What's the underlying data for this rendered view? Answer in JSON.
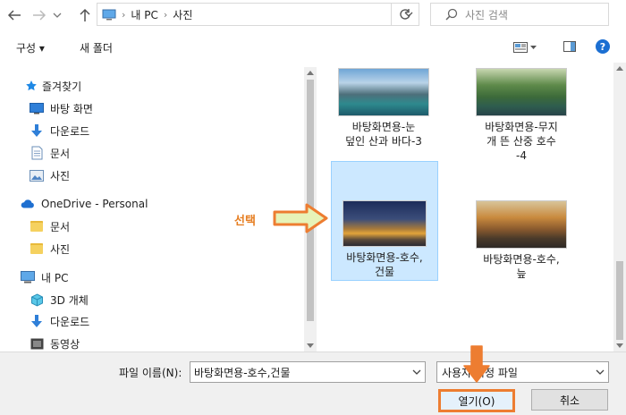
{
  "address_bar": {
    "crumbs": [
      "내 PC",
      "사진"
    ],
    "search_placeholder": "사진 검색"
  },
  "toolbar": {
    "organize_label": "구성 ▾",
    "new_folder_label": "새 폴더"
  },
  "sidebar": {
    "items": [
      {
        "label": "즐겨찾기",
        "icon": "star-icon"
      },
      {
        "label": "바탕 화면",
        "icon": "desktop-icon"
      },
      {
        "label": "다운로드",
        "icon": "download-icon"
      },
      {
        "label": "문서",
        "icon": "document-icon"
      },
      {
        "label": "사진",
        "icon": "pictures-icon"
      },
      {
        "label": "OneDrive - Personal",
        "icon": "cloud-icon"
      },
      {
        "label": "문서",
        "icon": "folder-icon"
      },
      {
        "label": "사진",
        "icon": "folder-icon"
      },
      {
        "label": "내 PC",
        "icon": "pc-icon"
      },
      {
        "label": "3D 개체",
        "icon": "cube-icon"
      },
      {
        "label": "다운로드",
        "icon": "download-icon"
      },
      {
        "label": "동영상",
        "icon": "video-icon"
      }
    ]
  },
  "files": [
    {
      "caption_lines": [
        "바탕화면용-눈",
        "덮인 산과 바다-3"
      ],
      "selected": false
    },
    {
      "caption_lines": [
        "바탕화면용-무지",
        "개 뜬 산중 호수",
        "-4"
      ],
      "selected": false
    },
    {
      "caption_lines": [
        "바탕화면용-호수,",
        "건물"
      ],
      "selected": true
    },
    {
      "caption_lines": [
        "바탕화면용-호수,",
        "늪"
      ],
      "selected": false
    }
  ],
  "annotation": {
    "select_label": "선택"
  },
  "bottom": {
    "filename_label": "파일 이름(N):",
    "filename_value": "바탕화면용-호수,건물",
    "filetype_value": "사용자 지정 파일",
    "open_label": "열기(O)",
    "cancel_label": "취소"
  },
  "colors": {
    "selection_bg": "#cce8ff",
    "selection_border": "#99d1ff",
    "annotation_orange": "#ed7d31",
    "accent_blue": "#0078d7"
  }
}
